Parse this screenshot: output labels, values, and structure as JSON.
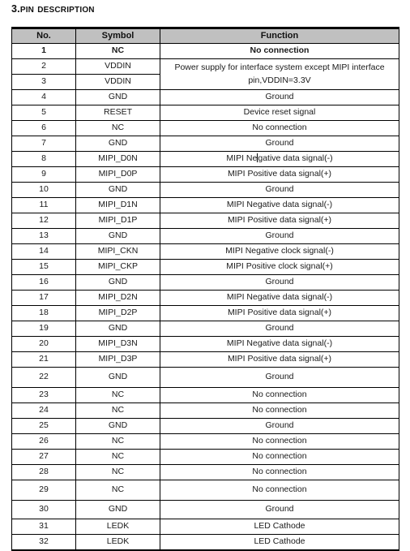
{
  "heading": {
    "number": "3.",
    "title": "Pin Description"
  },
  "table": {
    "columns": [
      "No.",
      "Symbol",
      "Function"
    ],
    "rows": [
      {
        "no": "1",
        "symbol": "NC",
        "function": "No connection",
        "bold": true
      },
      {
        "no": "2",
        "symbol": "VDDIN",
        "function": "Power supply for interface system except MIPI interface pin,VDDIN=3.3V",
        "merge_span": 2
      },
      {
        "no": "3",
        "symbol": "VDDIN",
        "function": null
      },
      {
        "no": "4",
        "symbol": "GND",
        "function": "Ground"
      },
      {
        "no": "5",
        "symbol": "RESET",
        "function": "Device reset signal"
      },
      {
        "no": "6",
        "symbol": "NC",
        "function": "No connection"
      },
      {
        "no": "7",
        "symbol": "GND",
        "function": "Ground"
      },
      {
        "no": "8",
        "symbol": "MIPI_D0N",
        "function": "MIPI Negative data signal(-)",
        "caret_after": "MIPI Ne"
      },
      {
        "no": "9",
        "symbol": "MIPI_D0P",
        "function": "MIPI Positive data signal(+)"
      },
      {
        "no": "10",
        "symbol": "GND",
        "function": "Ground"
      },
      {
        "no": "11",
        "symbol": "MIPI_D1N",
        "function": "MIPI Negative data signal(-)"
      },
      {
        "no": "12",
        "symbol": "MIPI_D1P",
        "function": "MIPI Positive data signal(+)"
      },
      {
        "no": "13",
        "symbol": "GND",
        "function": "Ground"
      },
      {
        "no": "14",
        "symbol": "MIPI_CKN",
        "function": "MIPI Negative clock signal(-)"
      },
      {
        "no": "15",
        "symbol": "MIPI_CKP",
        "function": "MIPI Positive clock signal(+)"
      },
      {
        "no": "16",
        "symbol": "GND",
        "function": "Ground"
      },
      {
        "no": "17",
        "symbol": "MIPI_D2N",
        "function": "MIPI Negative data signal(-)"
      },
      {
        "no": "18",
        "symbol": "MIPI_D2P",
        "function": "MIPI Positive data signal(+)"
      },
      {
        "no": "19",
        "symbol": "GND",
        "function": "Ground"
      },
      {
        "no": "20",
        "symbol": "MIPI_D3N",
        "function": "MIPI Negative data signal(-)"
      },
      {
        "no": "21",
        "symbol": "MIPI_D3P",
        "function": "MIPI Positive data signal(+)"
      },
      {
        "no": "22",
        "symbol": "GND",
        "function": "Ground",
        "tall": true
      },
      {
        "no": "23",
        "symbol": "NC",
        "function": "No connection"
      },
      {
        "no": "24",
        "symbol": "NC",
        "function": "No connection"
      },
      {
        "no": "25",
        "symbol": "GND",
        "function": "Ground"
      },
      {
        "no": "26",
        "symbol": "NC",
        "function": "No connection"
      },
      {
        "no": "27",
        "symbol": "NC",
        "function": "No connection"
      },
      {
        "no": "28",
        "symbol": "NC",
        "function": "No connection"
      },
      {
        "no": "29",
        "symbol": "NC",
        "function": "No connection",
        "tall": true
      },
      {
        "no": "30",
        "symbol": "GND",
        "function": "Ground",
        "tall_sm": true
      },
      {
        "no": "31",
        "symbol": "LEDK",
        "function": "LED Cathode"
      },
      {
        "no": "32",
        "symbol": "LEDK",
        "function": "LED Cathode"
      }
    ]
  },
  "colors": {
    "header_bg": "#c0c0c0",
    "border": "#000000",
    "page_bg": "#ffffff",
    "text": "#1a1a1a"
  }
}
